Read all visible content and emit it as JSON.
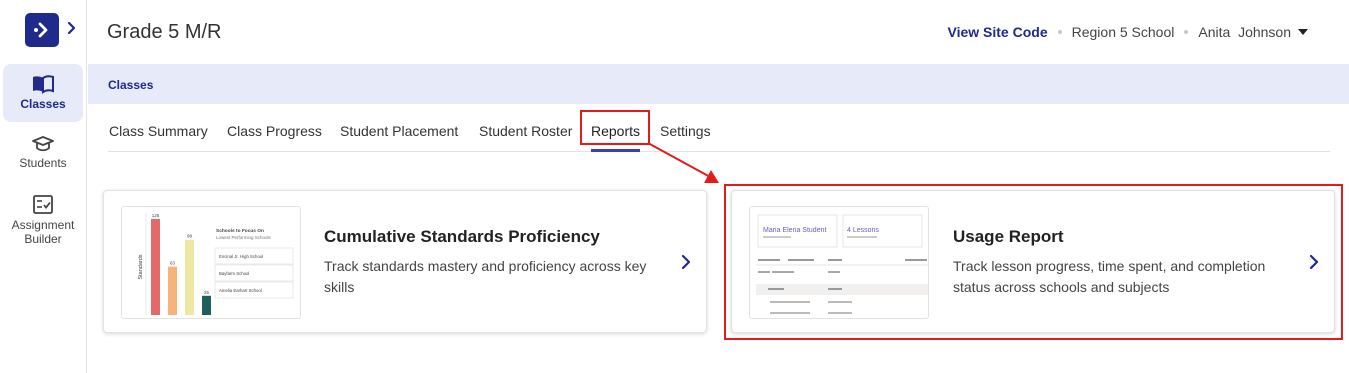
{
  "header": {
    "title": "Grade 5 M/R",
    "site_code": "View Site Code",
    "school": "Region 5 School",
    "user_first": "Anita",
    "user_last": "Johnson"
  },
  "sidebar": {
    "items": [
      {
        "label": "Classes",
        "icon": "book-icon",
        "active": true
      },
      {
        "label": "Students",
        "icon": "graduation-cap-icon"
      },
      {
        "label": "Assignment Builder",
        "icon": "checklist-icon"
      }
    ]
  },
  "breadcrumb": "Classes",
  "tabs": [
    "Class Summary",
    "Class Progress",
    "Student Placement",
    "Student Roster",
    "Reports",
    "Settings"
  ],
  "active_tab": "Reports",
  "cards": [
    {
      "title": "Cumulative Standards Proficiency",
      "desc_line1": "Track standards mastery and proficiency across key",
      "desc_line2": "skills",
      "thumb": {
        "axis_label": "Standards",
        "bar_values": [
          125,
          63,
          98,
          25
        ],
        "bar_colors": [
          "#e46a6a",
          "#f5b57a",
          "#eee7a2",
          "#1f5e5a"
        ],
        "heading1": "Schools to Focus On",
        "heading2": "Lowest Performing Schools",
        "schools": [
          "Encinal Jr. High School",
          "Bayfarm School",
          "Amelia Earhart School"
        ]
      }
    },
    {
      "title": "Usage Report",
      "desc_line1": "Track lesson progress, time spent, and completion",
      "desc_line2": "status across schools and subjects",
      "thumb": {
        "student_name": "Maria Elena Student",
        "lessons": "4 Lessons"
      }
    }
  ],
  "colors": {
    "brand": "#1f2a8a",
    "highlight": "#e31b1b",
    "tab_underline": "#3b3fb5",
    "breadcrumb_bg": "#e6eaf9"
  }
}
